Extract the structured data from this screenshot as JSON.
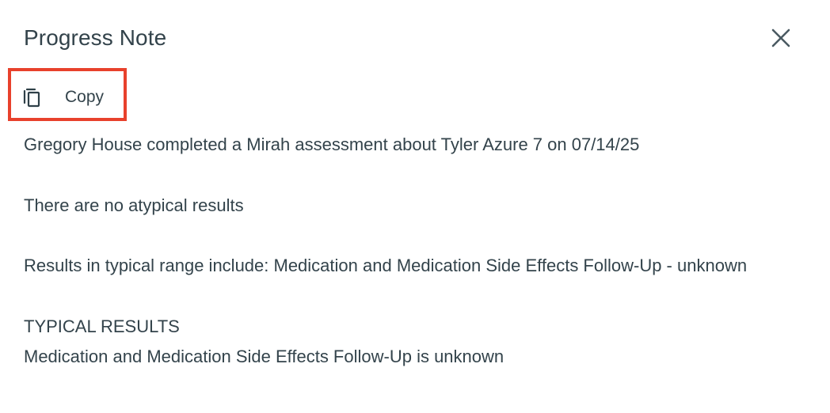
{
  "dialog": {
    "title": "Progress Note",
    "close_icon": "close-icon",
    "copy_button": {
      "label": "Copy",
      "icon": "copy-icon"
    },
    "highlight_color": "#e8412c",
    "note": {
      "line1": "Gregory House completed a Mirah assessment about Tyler Azure 7 on 07/14/25",
      "line2": "There are no atypical results",
      "line3": "Results in typical range include: Medication and Medication Side Effects Follow-Up - unknown",
      "line4": "TYPICAL RESULTS",
      "line5": "Medication and Medication Side Effects Follow-Up is unknown"
    }
  }
}
